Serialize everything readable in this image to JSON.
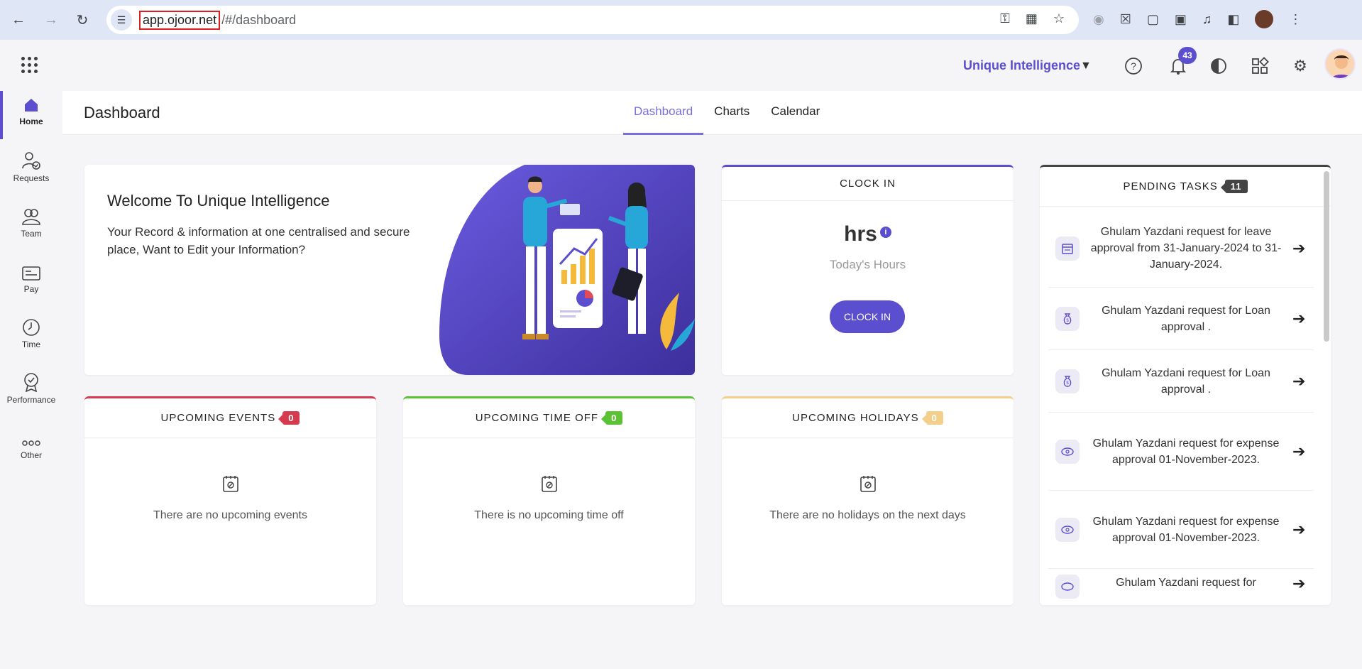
{
  "browser": {
    "url_host": "app.ojoor.net",
    "url_path": "/#/dashboard"
  },
  "header": {
    "org_name": "Unique Intelligence",
    "notification_count": "43"
  },
  "sidebar": {
    "items": [
      {
        "label": "Home"
      },
      {
        "label": "Requests"
      },
      {
        "label": "Team"
      },
      {
        "label": "Pay"
      },
      {
        "label": "Time"
      },
      {
        "label": "Performance"
      },
      {
        "label": "Other"
      }
    ]
  },
  "page": {
    "title": "Dashboard",
    "tabs": [
      {
        "label": "Dashboard"
      },
      {
        "label": "Charts"
      },
      {
        "label": "Calendar"
      }
    ]
  },
  "welcome": {
    "title": "Welcome To Unique Intelligence",
    "text": "Your Record & information at one centralised and secure place, Want to Edit your Information?"
  },
  "clock": {
    "title": "CLOCK IN",
    "hours": "hrs",
    "today_label": "Today's Hours",
    "button_label": "CLOCK IN"
  },
  "pending": {
    "title": "PENDING TASKS",
    "count": "11",
    "tasks": [
      {
        "text": "Ghulam Yazdani request for leave approval from 31-January-2024 to 31-January-2024.",
        "icon": "calendar-icon"
      },
      {
        "text": "Ghulam Yazdani request for Loan approval .",
        "icon": "money-bag-icon"
      },
      {
        "text": "Ghulam Yazdani request for Loan approval .",
        "icon": "money-bag-icon"
      },
      {
        "text": "Ghulam Yazdani request for expense approval 01-November-2023.",
        "icon": "cash-icon"
      },
      {
        "text": "Ghulam Yazdani request for expense approval 01-November-2023.",
        "icon": "cash-icon"
      },
      {
        "text": "Ghulam Yazdani request for",
        "icon": "cash-icon"
      }
    ]
  },
  "events": {
    "title": "UPCOMING EVENTS",
    "count": "0",
    "empty": "There are no upcoming events"
  },
  "timeoff": {
    "title": "UPCOMING TIME OFF",
    "count": "0",
    "empty": "There is no upcoming time off"
  },
  "holidays": {
    "title": "UPCOMING HOLIDAYS",
    "count": "0",
    "empty": "There are no holidays on the next days"
  },
  "colors": {
    "accent": "#5b4fd0",
    "events": "#d63a4e",
    "timeoff": "#5bc236",
    "holidays": "#f3cf8a",
    "pending_badge": "#444444"
  }
}
